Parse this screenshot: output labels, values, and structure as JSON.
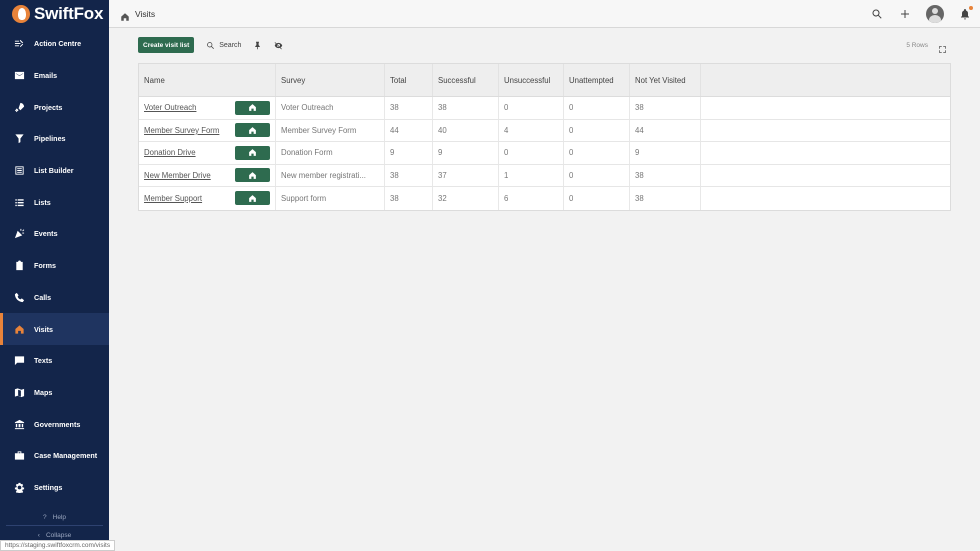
{
  "app": {
    "brand": "SwiftFox"
  },
  "sidebar": {
    "items": [
      {
        "label": "Action Centre",
        "icon": "action-centre-icon"
      },
      {
        "label": "Emails",
        "icon": "mail-icon"
      },
      {
        "label": "Projects",
        "icon": "rocket-icon"
      },
      {
        "label": "Pipelines",
        "icon": "filter-icon"
      },
      {
        "label": "List Builder",
        "icon": "list-builder-icon"
      },
      {
        "label": "Lists",
        "icon": "list-icon"
      },
      {
        "label": "Events",
        "icon": "party-icon"
      },
      {
        "label": "Forms",
        "icon": "clipboard-icon"
      },
      {
        "label": "Calls",
        "icon": "phone-icon"
      },
      {
        "label": "Visits",
        "icon": "house-walk-icon",
        "active": true
      },
      {
        "label": "Texts",
        "icon": "chat-icon"
      },
      {
        "label": "Maps",
        "icon": "map-icon"
      },
      {
        "label": "Governments",
        "icon": "building-icon"
      },
      {
        "label": "Case Management",
        "icon": "briefcase-icon"
      },
      {
        "label": "Settings",
        "icon": "gear-icon"
      }
    ],
    "help_label": "Help",
    "collapse_label": "Collapse"
  },
  "status_url": "https://staging.swiftfoxcrm.com/visits",
  "header": {
    "title": "Visits"
  },
  "toolbar": {
    "create_label": "Create visit list",
    "search_label": "Search",
    "rows_label": "5 Rows"
  },
  "table": {
    "columns": [
      "Name",
      "Survey",
      "Total",
      "Successful",
      "Unsuccessful",
      "Unattempted",
      "Not Yet Visited"
    ],
    "rows": [
      {
        "name": "Voter Outreach",
        "survey": "Voter Outreach",
        "total": "38",
        "successful": "38",
        "unsuccessful": "0",
        "unattempted": "0",
        "not_yet_visited": "38"
      },
      {
        "name": "Member Survey Form",
        "survey": "Member Survey Form",
        "total": "44",
        "successful": "40",
        "unsuccessful": "4",
        "unattempted": "0",
        "not_yet_visited": "44"
      },
      {
        "name": "Donation Drive",
        "survey": "Donation Form",
        "total": "9",
        "successful": "9",
        "unsuccessful": "0",
        "unattempted": "0",
        "not_yet_visited": "9"
      },
      {
        "name": "New Member Drive",
        "survey": "New member registrati...",
        "total": "38",
        "successful": "37",
        "unsuccessful": "1",
        "unattempted": "0",
        "not_yet_visited": "38"
      },
      {
        "name": "Member Support",
        "survey": "Support form",
        "total": "38",
        "successful": "32",
        "unsuccessful": "6",
        "unattempted": "0",
        "not_yet_visited": "38"
      }
    ]
  },
  "colors": {
    "sidebar": "#13254a",
    "accent": "#e8833a",
    "primary_button": "#2e6b4f"
  }
}
